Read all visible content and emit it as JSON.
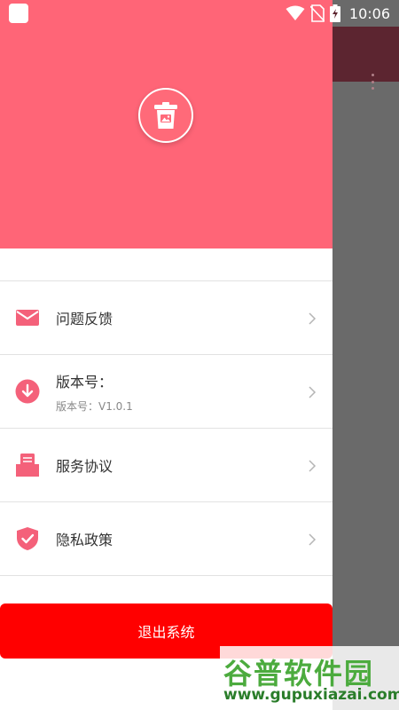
{
  "status_bar": {
    "time": "10:06",
    "icons": [
      "app-notification-icon",
      "wifi-icon",
      "no-sim-icon",
      "battery-charging-icon"
    ]
  },
  "background_app": {
    "toolbar_menu_icon": "more-vert-icon"
  },
  "drawer": {
    "logo_icon": "trash-can-icon",
    "colors": {
      "header": "#ff6577",
      "accent": "#f4617a",
      "logout": "#ff0000"
    },
    "items": [
      {
        "label": "问题反馈",
        "icon": "mail-icon"
      },
      {
        "label": "版本号：",
        "sub": "版本号：V1.0.1",
        "icon": "download-icon"
      },
      {
        "label": "服务协议",
        "icon": "document-icon"
      },
      {
        "label": "隐私政策",
        "icon": "shield-check-icon"
      }
    ],
    "logout_label": "退出系统"
  },
  "watermark": {
    "title": "谷普软件园",
    "url": "www.gupuxiazai.com"
  }
}
